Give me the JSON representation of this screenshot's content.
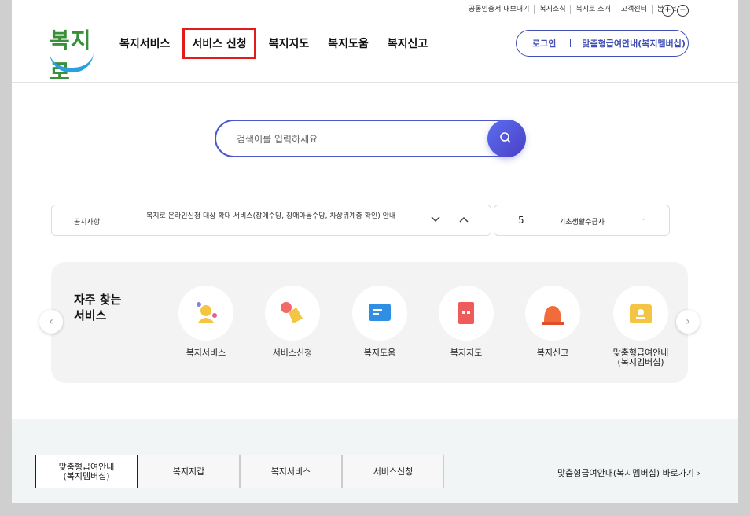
{
  "util_links": [
    "공동인증서 내보내기",
    "복지소식",
    "복지로 소개",
    "고객센터",
    "본문크기"
  ],
  "zoom": {
    "plus": "+",
    "minus": "−"
  },
  "logo": {
    "text": "복지로"
  },
  "gnb": [
    "복지서비스",
    "서비스 신청",
    "복지지도",
    "복지도움",
    "복지신고"
  ],
  "login": {
    "login_label": "로그인",
    "member_label": "맞춤형급여안내(복지멤버십)"
  },
  "search": {
    "placeholder": "검색어를 입력하세요"
  },
  "notice": {
    "label": "공지사항",
    "text": "복지로 온라인신청 대상 확대 서비스(장애수당, 장애아동수당, 차상위계층 확인) 안내"
  },
  "stat": {
    "number": "5",
    "label": "기초생활수급자",
    "dash": "-"
  },
  "favorites": {
    "title_line1": "자주 찾는",
    "title_line2": "서비스",
    "items": [
      {
        "label": "복지서비스",
        "icon": "person-icon"
      },
      {
        "label": "서비스신청",
        "icon": "hand-pointer-icon"
      },
      {
        "label": "복지도움",
        "icon": "chat-bubble-icon"
      },
      {
        "label": "복지지도",
        "icon": "map-icon"
      },
      {
        "label": "복지신고",
        "icon": "siren-icon"
      },
      {
        "label": "맞춤형급여안내\n(복지멤버십)",
        "icon": "id-card-icon"
      }
    ]
  },
  "tabs": [
    "맞춤형급여안내\n(복지멤버십)",
    "복지지갑",
    "복지서비스",
    "서비스신청"
  ],
  "shortcut": "맞춤형급여안내(복지멤버십) 바로가기",
  "colors": {
    "accent": "#4a58c8",
    "highlight": "#e21b1b",
    "logo_green": "#3a8f3a",
    "logo_blue": "#2aa0e0"
  }
}
